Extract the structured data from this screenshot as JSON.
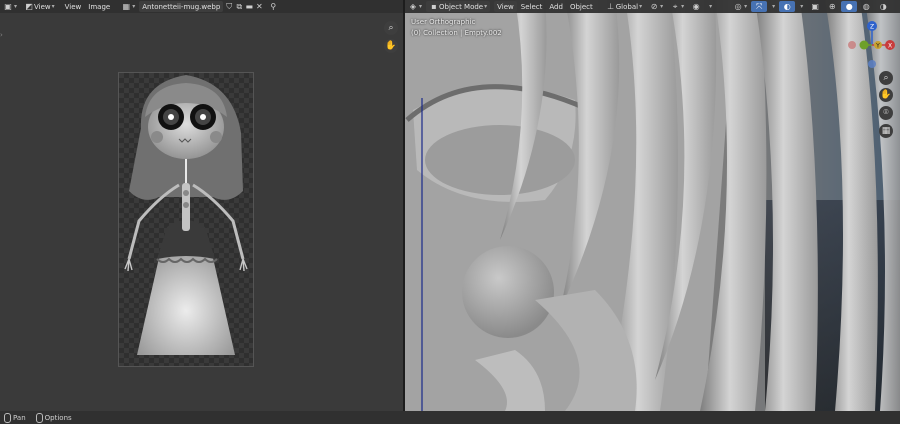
{
  "left_editor": {
    "menu_view": "View",
    "menu_view2": "View",
    "menu_image": "Image",
    "image_name": "Antonetteii-mug.webp"
  },
  "viewport": {
    "mode": "Object Mode",
    "menu_view": "View",
    "menu_select": "Select",
    "menu_add": "Add",
    "menu_object": "Object",
    "orientation": "Global",
    "view_name": "User Orthographic",
    "collection_info": "(0) Collection | Empty.002",
    "gizmo": {
      "z": "Z",
      "y": "Y",
      "x": "X"
    }
  },
  "statusbar": {
    "pan": "Pan",
    "options": "Options"
  },
  "colors": {
    "accent": "#4772b3",
    "header": "#303030",
    "x_axis": "#c83c3c",
    "y_axis": "#6ea02a",
    "z_axis": "#2f62cc"
  }
}
